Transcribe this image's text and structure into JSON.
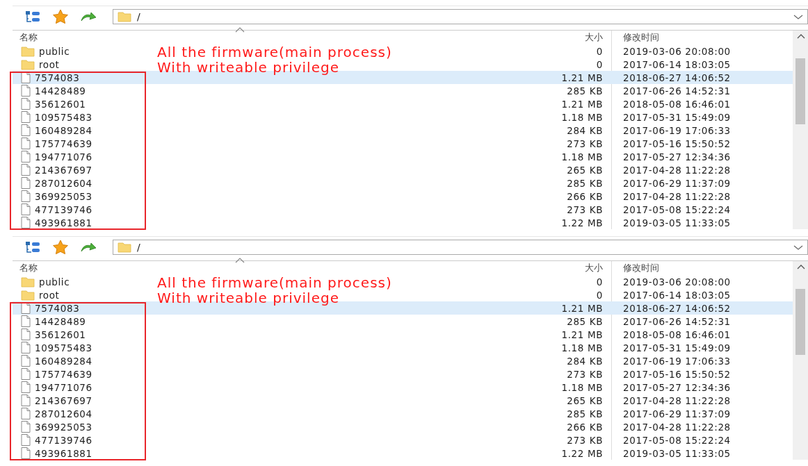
{
  "panels": [
    {
      "path": "/",
      "columns": [
        "名称",
        "大小",
        "修改时间"
      ],
      "annotation": [
        "All the firmware(main process)",
        "With writeable privilege"
      ],
      "rows": [
        {
          "kind": "folder",
          "name": "public",
          "size": "0",
          "modified": "2019-03-06 20:08:00",
          "selected": false
        },
        {
          "kind": "folder",
          "name": "root",
          "size": "0",
          "modified": "2017-06-14 18:03:05",
          "selected": false
        },
        {
          "kind": "file",
          "name": "7574083",
          "size": "1.21 MB",
          "modified": "2018-06-27 14:06:52",
          "selected": true
        },
        {
          "kind": "file",
          "name": "14428489",
          "size": "285 KB",
          "modified": "2017-06-26 14:52:31",
          "selected": false
        },
        {
          "kind": "file",
          "name": "35612601",
          "size": "1.21 MB",
          "modified": "2018-05-08 16:46:01",
          "selected": false
        },
        {
          "kind": "file",
          "name": "109575483",
          "size": "1.18 MB",
          "modified": "2017-05-31 15:49:09",
          "selected": false
        },
        {
          "kind": "file",
          "name": "160489284",
          "size": "284 KB",
          "modified": "2017-06-19 17:06:33",
          "selected": false
        },
        {
          "kind": "file",
          "name": "175774639",
          "size": "273 KB",
          "modified": "2017-05-16 15:50:52",
          "selected": false
        },
        {
          "kind": "file",
          "name": "194771076",
          "size": "1.18 MB",
          "modified": "2017-05-27 12:34:36",
          "selected": false
        },
        {
          "kind": "file",
          "name": "214367697",
          "size": "265 KB",
          "modified": "2017-04-28 11:22:28",
          "selected": false
        },
        {
          "kind": "file",
          "name": "287012604",
          "size": "285 KB",
          "modified": "2017-06-29 11:37:09",
          "selected": false
        },
        {
          "kind": "file",
          "name": "369925053",
          "size": "266 KB",
          "modified": "2017-04-28 11:22:28",
          "selected": false
        },
        {
          "kind": "file",
          "name": "477139746",
          "size": "273 KB",
          "modified": "2017-05-08 15:22:24",
          "selected": false
        },
        {
          "kind": "file",
          "name": "493961881",
          "size": "1.22 MB",
          "modified": "2019-03-05 11:33:05",
          "selected": false
        }
      ]
    },
    {
      "path": "/",
      "columns": [
        "名称",
        "大小",
        "修改时间"
      ],
      "annotation": [
        "All the firmware(main process)",
        "With writeable privilege"
      ],
      "rows": [
        {
          "kind": "folder",
          "name": "public",
          "size": "0",
          "modified": "2019-03-06 20:08:00",
          "selected": false
        },
        {
          "kind": "folder",
          "name": "root",
          "size": "0",
          "modified": "2017-06-14 18:03:05",
          "selected": false
        },
        {
          "kind": "file",
          "name": "7574083",
          "size": "1.21 MB",
          "modified": "2018-06-27 14:06:52",
          "selected": true
        },
        {
          "kind": "file",
          "name": "14428489",
          "size": "285 KB",
          "modified": "2017-06-26 14:52:31",
          "selected": false
        },
        {
          "kind": "file",
          "name": "35612601",
          "size": "1.21 MB",
          "modified": "2018-05-08 16:46:01",
          "selected": false
        },
        {
          "kind": "file",
          "name": "109575483",
          "size": "1.18 MB",
          "modified": "2017-05-31 15:49:09",
          "selected": false
        },
        {
          "kind": "file",
          "name": "160489284",
          "size": "284 KB",
          "modified": "2017-06-19 17:06:33",
          "selected": false
        },
        {
          "kind": "file",
          "name": "175774639",
          "size": "273 KB",
          "modified": "2017-05-16 15:50:52",
          "selected": false
        },
        {
          "kind": "file",
          "name": "194771076",
          "size": "1.18 MB",
          "modified": "2017-05-27 12:34:36",
          "selected": false
        },
        {
          "kind": "file",
          "name": "214367697",
          "size": "265 KB",
          "modified": "2017-04-28 11:22:28",
          "selected": false
        },
        {
          "kind": "file",
          "name": "287012604",
          "size": "285 KB",
          "modified": "2017-06-29 11:37:09",
          "selected": false
        },
        {
          "kind": "file",
          "name": "369925053",
          "size": "266 KB",
          "modified": "2017-04-28 11:22:28",
          "selected": false
        },
        {
          "kind": "file",
          "name": "477139746",
          "size": "273 KB",
          "modified": "2017-05-08 15:22:24",
          "selected": false
        },
        {
          "kind": "file",
          "name": "493961881",
          "size": "1.22 MB",
          "modified": "2019-03-05 11:33:05",
          "selected": false
        }
      ]
    }
  ]
}
